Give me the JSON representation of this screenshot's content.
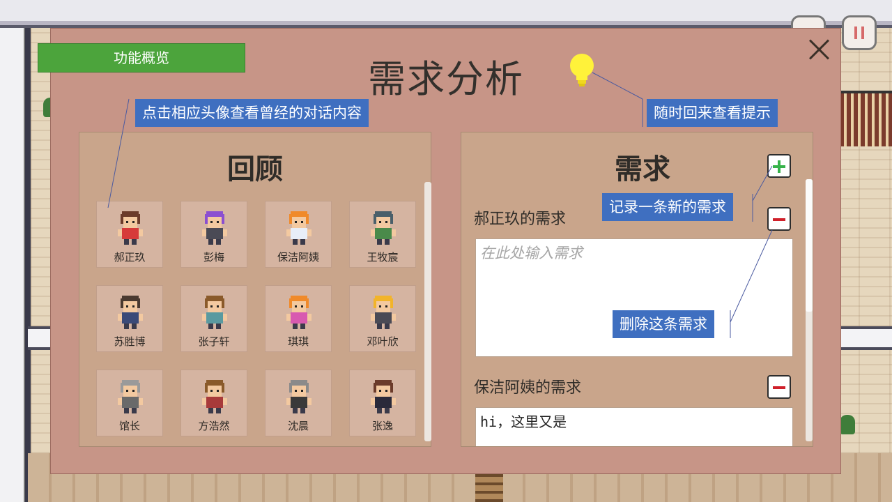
{
  "tag_overview": "功能概览",
  "title": "需求分析",
  "review_panel": {
    "title": "回顾",
    "characters": [
      {
        "name": "郝正玖",
        "hair": "#6b3b2a",
        "shirt": "#d63a3a"
      },
      {
        "name": "彭梅",
        "hair": "#8b4fd0",
        "shirt": "#4a4a55"
      },
      {
        "name": "保洁阿姨",
        "hair": "#f08a2a",
        "shirt": "#e8eef8"
      },
      {
        "name": "王牧宸",
        "hair": "#4a5f6a",
        "shirt": "#4a8a4a"
      },
      {
        "name": "苏胜博",
        "hair": "#4a3a30",
        "shirt": "#3a4a78"
      },
      {
        "name": "张子轩",
        "hair": "#8a5a2a",
        "shirt": "#5a9aa0"
      },
      {
        "name": "琪琪",
        "hair": "#f08a2a",
        "shirt": "#d85ab0"
      },
      {
        "name": "邓叶欣",
        "hair": "#f2b42a",
        "shirt": "#4a4a55"
      },
      {
        "name": "馆长",
        "hair": "#9a9a9a",
        "shirt": "#6a6a6a"
      },
      {
        "name": "方浩然",
        "hair": "#8a5a2a",
        "shirt": "#a83a3a"
      },
      {
        "name": "沈晨",
        "hair": "#8a8a8a",
        "shirt": "#3a3a3a"
      },
      {
        "name": "张逸",
        "hair": "#6b3b2a",
        "shirt": "#2a2a3a"
      }
    ]
  },
  "needs_panel": {
    "title": "需求",
    "entries": [
      {
        "label": "郝正玖的需求",
        "placeholder": "在此处输入需求",
        "value": ""
      },
      {
        "label": "保洁阿姨的需求",
        "placeholder": "",
        "value": "hi，这里又是"
      }
    ]
  },
  "callouts": {
    "avatar_hint": "点击相应头像查看曾经的对话内容",
    "tips_hint": "随时回来查看提示",
    "add_hint": "记录一条新的需求",
    "delete_hint": "删除这条需求"
  },
  "colors": {
    "modal": "#c79587",
    "panel": "#c9a58b",
    "callout_blue": "#3f6fc0",
    "callout_green": "#4ca43c",
    "bulb": "#fff23a"
  },
  "icons": [
    "lightbulb-icon",
    "close-icon",
    "plus-icon",
    "minus-icon",
    "pause-icon"
  ]
}
